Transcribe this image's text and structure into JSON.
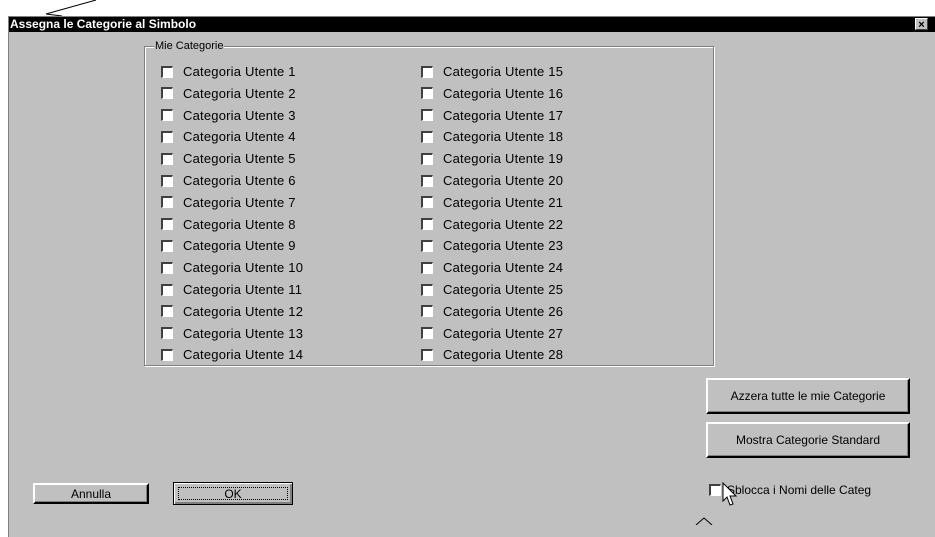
{
  "dialog": {
    "title": "Assegna le Categorie al Simbolo",
    "close_label": "×"
  },
  "group": {
    "legend": "Mie Categorie",
    "left_column": [
      "Categoria Utente 1",
      "Categoria Utente 2",
      "Categoria Utente 3",
      "Categoria Utente 4",
      "Categoria Utente 5",
      "Categoria Utente 6",
      "Categoria Utente 7",
      "Categoria Utente 8",
      "Categoria Utente 9",
      "Categoria Utente 10",
      "Categoria Utente 11",
      "Categoria Utente 12",
      "Categoria Utente 13",
      "Categoria Utente 14"
    ],
    "right_column": [
      "Categoria Utente 15",
      "Categoria Utente 16",
      "Categoria Utente 17",
      "Categoria Utente 18",
      "Categoria Utente 19",
      "Categoria Utente 20",
      "Categoria Utente 21",
      "Categoria Utente 22",
      "Categoria Utente 23",
      "Categoria Utente 24",
      "Categoria Utente 25",
      "Categoria Utente 26",
      "Categoria Utente 27",
      "Categoria Utente 28"
    ]
  },
  "buttons": {
    "reset": "Azzera tutte le mie Categorie",
    "show_standard": "Mostra Categorie Standard",
    "cancel": "Annulla",
    "ok": "OK"
  },
  "unlock_checkbox": {
    "label": "Sblocca i Nomi delle Categ"
  }
}
